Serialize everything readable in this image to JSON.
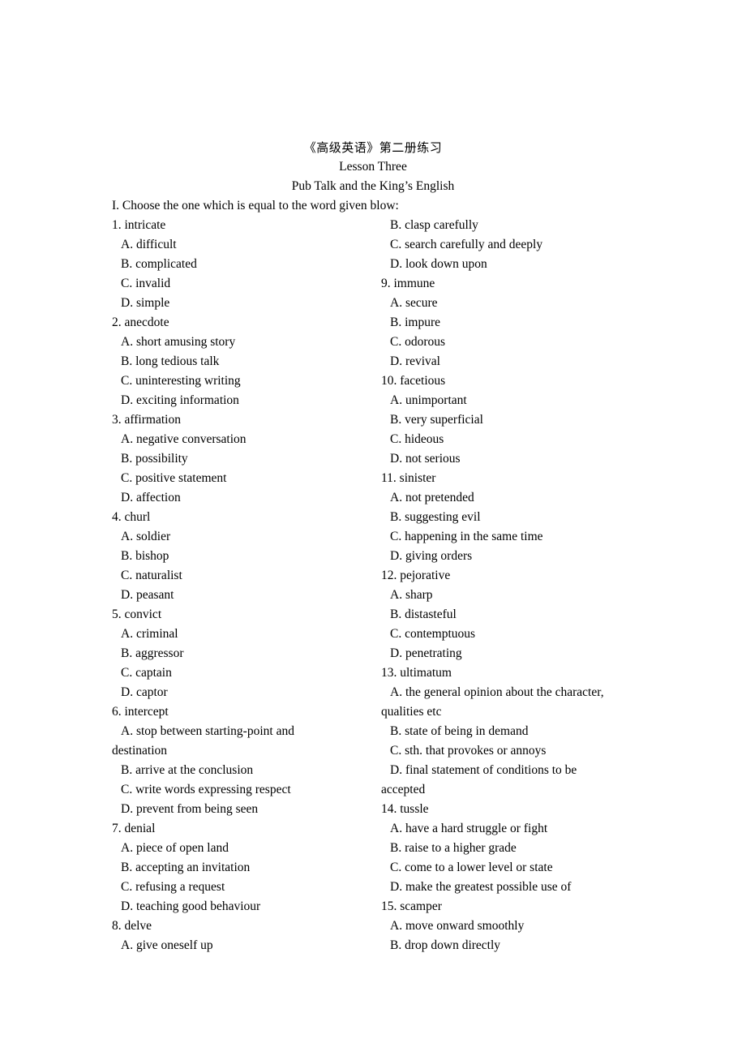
{
  "document": {
    "title_cjk": "《高级英语》第二册练习",
    "lesson": "Lesson Three",
    "lesson_title": "Pub Talk and the King’s English",
    "instruction": "I. Choose the one which is equal to the word given blow:"
  },
  "rows": [
    {
      "left": {
        "text": "1. intricate",
        "indent": 0
      },
      "right": {
        "text": "B. clasp carefully",
        "indent": 1
      }
    },
    {
      "left": {
        "text": "A. difficult",
        "indent": 1
      },
      "right": {
        "text": "C. search carefully and deeply",
        "indent": 1
      }
    },
    {
      "left": {
        "text": "B. complicated",
        "indent": 1
      },
      "right": {
        "text": "D. look down upon",
        "indent": 1
      }
    },
    {
      "left": {
        "text": "C. invalid",
        "indent": 1
      },
      "right": {
        "text": "9. immune",
        "indent": 0
      }
    },
    {
      "left": {
        "text": "D. simple",
        "indent": 1
      },
      "right": {
        "text": "A. secure",
        "indent": 1
      }
    },
    {
      "left": {
        "text": "2. anecdote",
        "indent": 0
      },
      "right": {
        "text": "B. impure",
        "indent": 1
      }
    },
    {
      "left": {
        "text": "A. short amusing story",
        "indent": 1
      },
      "right": {
        "text": "C. odorous",
        "indent": 1
      }
    },
    {
      "left": {
        "text": "B. long tedious talk",
        "indent": 1
      },
      "right": {
        "text": "D. revival",
        "indent": 1
      }
    },
    {
      "left": {
        "text": "C. uninteresting writing",
        "indent": 1
      },
      "right": {
        "text": "10. facetious",
        "indent": 0
      }
    },
    {
      "left": {
        "text": "D. exciting information",
        "indent": 1
      },
      "right": {
        "text": "A. unimportant",
        "indent": 1
      }
    },
    {
      "left": {
        "text": "3. affirmation",
        "indent": 0
      },
      "right": {
        "text": "B. very superficial",
        "indent": 1
      }
    },
    {
      "left": {
        "text": "A. negative conversation",
        "indent": 1
      },
      "right": {
        "text": "C. hideous",
        "indent": 1
      }
    },
    {
      "left": {
        "text": "B. possibility",
        "indent": 1
      },
      "right": {
        "text": "D. not serious",
        "indent": 1
      }
    },
    {
      "left": {
        "text": "C. positive statement",
        "indent": 1
      },
      "right": {
        "text": "11. sinister",
        "indent": 0
      }
    },
    {
      "left": {
        "text": "D. affection",
        "indent": 1
      },
      "right": {
        "text": "A. not pretended",
        "indent": 1
      }
    },
    {
      "left": {
        "text": "4. churl",
        "indent": 0
      },
      "right": {
        "text": "B. suggesting evil",
        "indent": 1
      }
    },
    {
      "left": {
        "text": "A. soldier",
        "indent": 1
      },
      "right": {
        "text": "C. happening in the same time",
        "indent": 1
      }
    },
    {
      "left": {
        "text": "B. bishop",
        "indent": 1
      },
      "right": {
        "text": "D. giving orders",
        "indent": 1
      }
    },
    {
      "left": {
        "text": "C. naturalist",
        "indent": 1
      },
      "right": {
        "text": "12. pejorative",
        "indent": 0
      }
    },
    {
      "left": {
        "text": "D. peasant",
        "indent": 1
      },
      "right": {
        "text": "A. sharp",
        "indent": 1
      }
    },
    {
      "left": {
        "text": "5. convict",
        "indent": 0
      },
      "right": {
        "text": "B. distasteful",
        "indent": 1
      }
    },
    {
      "left": {
        "text": "A. criminal",
        "indent": 1
      },
      "right": {
        "text": "C. contemptuous",
        "indent": 1
      }
    },
    {
      "left": {
        "text": "B. aggressor",
        "indent": 1
      },
      "right": {
        "text": "D. penetrating",
        "indent": 1
      }
    },
    {
      "left": {
        "text": "C. captain",
        "indent": 1
      },
      "right": {
        "text": "13. ultimatum",
        "indent": 0
      }
    },
    {
      "left": {
        "text": "D. captor",
        "indent": 1
      },
      "right": {
        "text": "A. the general opinion about the character,",
        "indent": 1
      }
    },
    {
      "left": {
        "text": "6. intercept",
        "indent": 0
      },
      "right": {
        "text": "qualities etc",
        "indent": 0
      }
    },
    {
      "left": {
        "text": "A. stop between starting-point and",
        "indent": 1
      },
      "right": {
        "text": "B. state of being in demand",
        "indent": 1
      }
    },
    {
      "left": {
        "text": "destination",
        "indent": 0
      },
      "right": {
        "text": "C. sth. that provokes or annoys",
        "indent": 1
      }
    },
    {
      "left": {
        "text": "B. arrive at the conclusion",
        "indent": 1
      },
      "right": {
        "text": "D. final statement of conditions to be",
        "indent": 1
      }
    },
    {
      "left": {
        "text": "C. write words expressing respect",
        "indent": 1
      },
      "right": {
        "text": "accepted",
        "indent": 0
      }
    },
    {
      "left": {
        "text": "D. prevent from being seen",
        "indent": 1
      },
      "right": {
        "text": "14. tussle",
        "indent": 0
      }
    },
    {
      "left": {
        "text": "7. denial",
        "indent": 0
      },
      "right": {
        "text": "A. have a hard struggle or fight",
        "indent": 1
      }
    },
    {
      "left": {
        "text": "A. piece of open land",
        "indent": 1
      },
      "right": {
        "text": "B. raise to a higher grade",
        "indent": 1
      }
    },
    {
      "left": {
        "text": "B. accepting an invitation",
        "indent": 1
      },
      "right": {
        "text": "C. come to a lower level or state",
        "indent": 1
      }
    },
    {
      "left": {
        "text": "C. refusing a request",
        "indent": 1
      },
      "right": {
        "text": "D. make the greatest possible use of",
        "indent": 1
      }
    },
    {
      "left": {
        "text": "D. teaching good behaviour",
        "indent": 1
      },
      "right": {
        "text": "15. scamper",
        "indent": 0
      }
    },
    {
      "left": {
        "text": "8. delve",
        "indent": 0
      },
      "right": {
        "text": "A. move onward smoothly",
        "indent": 1
      }
    },
    {
      "left": {
        "text": "A. give oneself up",
        "indent": 1
      },
      "right": {
        "text": "B. drop down directly",
        "indent": 1
      }
    }
  ]
}
